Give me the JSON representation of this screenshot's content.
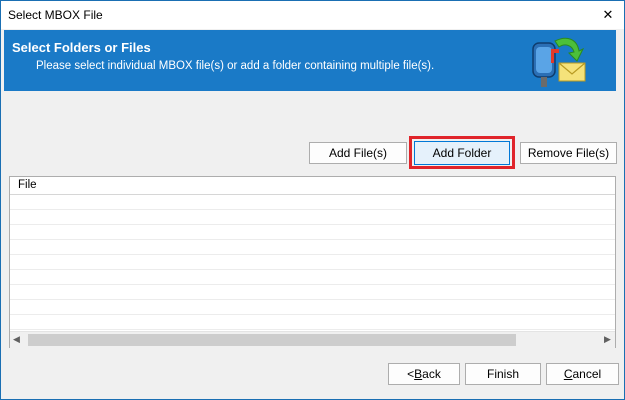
{
  "window": {
    "title": "Select MBOX File",
    "close_glyph": "✕"
  },
  "header": {
    "title": "Select Folders or Files",
    "subtitle": "Please select individual MBOX file(s) or add a folder containing multiple file(s).",
    "icon": "mailbox-with-arrow-icon",
    "background_color": "#1a7ac7"
  },
  "toolbar": {
    "add_files_label": "Add File(s)",
    "add_folder_label": "Add Folder",
    "remove_files_label": "Remove File(s)",
    "highlighted": "add_folder"
  },
  "file_list": {
    "column_header": "File",
    "rows": []
  },
  "footer": {
    "back_mnemonic": "B",
    "back_rest": "ack",
    "back_prefix": "<",
    "finish_label": "Finish",
    "cancel_mnemonic": "C",
    "cancel_rest": "ancel"
  },
  "colors": {
    "highlight_border": "#e0242a",
    "accent": "#0078d7"
  }
}
